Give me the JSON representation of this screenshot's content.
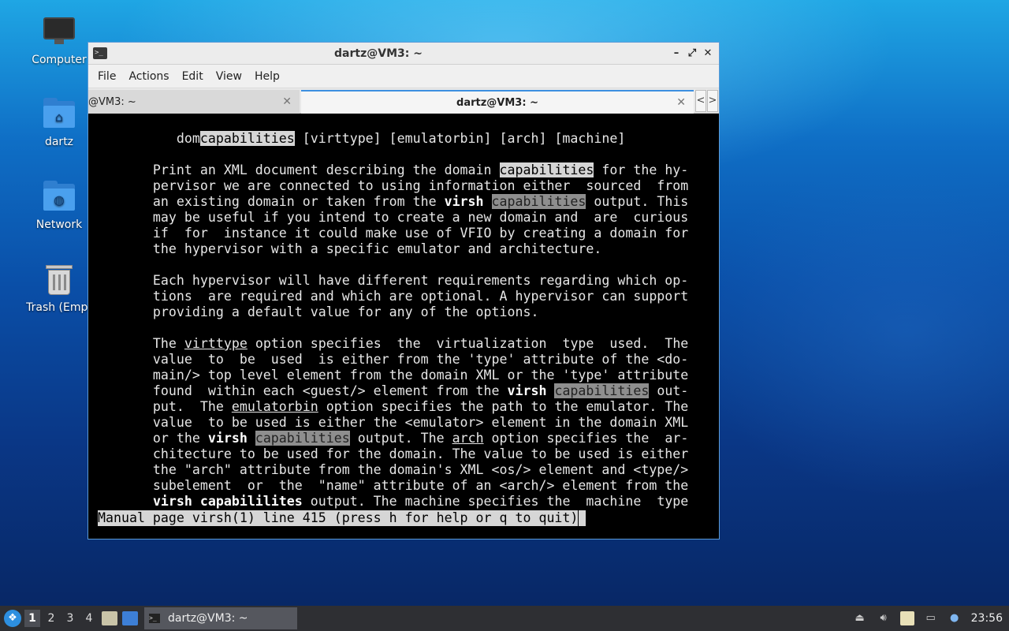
{
  "desktop": {
    "icons": [
      {
        "label": "Computer",
        "icon": "computer-icon"
      },
      {
        "label": "dartz",
        "icon": "home-folder-icon"
      },
      {
        "label": "Network",
        "icon": "network-folder-icon"
      },
      {
        "label": "Trash (Empt",
        "icon": "trash-icon"
      }
    ]
  },
  "window": {
    "title": "dartz@VM3: ~",
    "controls": {
      "minimize": "–",
      "maximize": "⤢",
      "close": "✕"
    },
    "menu": [
      "File",
      "Actions",
      "Edit",
      "View",
      "Help"
    ],
    "tabs": [
      {
        "label": "@VM3: ~",
        "close": "✕",
        "active": false
      },
      {
        "label": "dartz@VM3: ~",
        "close": "✕",
        "active": true
      }
    ],
    "tab_nav": {
      "prev": "<",
      "next": ">"
    }
  },
  "terminal": {
    "lines": [
      [
        {
          "t": "          dom"
        },
        {
          "t": "capabilities",
          "s": "hl"
        },
        {
          "t": " [virttype] [emulatorbin] [arch] [machine]"
        }
      ],
      [],
      [
        {
          "t": "       Print an XML document describing the domain "
        },
        {
          "t": "capabilities",
          "s": "hl"
        },
        {
          "t": " for the hy-"
        }
      ],
      [
        {
          "t": "       pervisor we are connected to using information either  sourced  from"
        }
      ],
      [
        {
          "t": "       an existing domain or taken from the "
        },
        {
          "t": "virsh",
          "s": "b"
        },
        {
          "t": " "
        },
        {
          "t": "capabilities",
          "s": "hl2"
        },
        {
          "t": " output. This"
        }
      ],
      [
        {
          "t": "       may be useful if you intend to create a new domain and  are  curious"
        }
      ],
      [
        {
          "t": "       if  for  instance it could make use of VFIO by creating a domain for"
        }
      ],
      [
        {
          "t": "       the hypervisor with a specific emulator and architecture."
        }
      ],
      [],
      [
        {
          "t": "       Each hypervisor will have different requirements regarding which op-"
        }
      ],
      [
        {
          "t": "       tions  are required and which are optional. A hypervisor can support"
        }
      ],
      [
        {
          "t": "       providing a default value for any of the options."
        }
      ],
      [],
      [
        {
          "t": "       The "
        },
        {
          "t": "virttype",
          "s": "u"
        },
        {
          "t": " option specifies  the  virtualization  type  used.  The"
        }
      ],
      [
        {
          "t": "       value  to  be  used  is either from the 'type' attribute of the <do-"
        }
      ],
      [
        {
          "t": "       main/> top level element from the domain XML or the 'type' attribute"
        }
      ],
      [
        {
          "t": "       found  within each <guest/> element from the "
        },
        {
          "t": "virsh",
          "s": "b"
        },
        {
          "t": " "
        },
        {
          "t": "capabilities",
          "s": "hl2"
        },
        {
          "t": " out-"
        }
      ],
      [
        {
          "t": "       put.  The "
        },
        {
          "t": "emulatorbin",
          "s": "u"
        },
        {
          "t": " option specifies the path to the emulator. The"
        }
      ],
      [
        {
          "t": "       value  to be used is either the <emulator> element in the domain XML"
        }
      ],
      [
        {
          "t": "       or the "
        },
        {
          "t": "virsh",
          "s": "b"
        },
        {
          "t": " "
        },
        {
          "t": "capabilities",
          "s": "hl2"
        },
        {
          "t": " output. The "
        },
        {
          "t": "arch",
          "s": "u"
        },
        {
          "t": " option specifies the  ar-"
        }
      ],
      [
        {
          "t": "       chitecture to be used for the domain. The value to be used is either"
        }
      ],
      [
        {
          "t": "       the \"arch\" attribute from the domain's XML <os/> element and <type/>"
        }
      ],
      [
        {
          "t": "       subelement  or  the  \"name\" attribute of an <arch/> element from the"
        }
      ],
      [
        {
          "t": "       "
        },
        {
          "t": "virsh capabililites",
          "s": "b"
        },
        {
          "t": " output. The machine specifies the  machine  type"
        }
      ]
    ],
    "status": "Manual page virsh(1) line 415 (press h for help or q to quit)"
  },
  "taskbar": {
    "start_icon": "start-menu-icon",
    "workspaces": [
      "1",
      "2",
      "3",
      "4"
    ],
    "active_workspace": "1",
    "launchers": [
      "file-manager-icon",
      "show-desktop-icon"
    ],
    "task": {
      "label": "dartz@VM3: ~",
      "icon": "terminal-icon"
    },
    "tray": [
      "eject-icon",
      "volume-icon",
      "clipboard-icon",
      "network-icon",
      "notification-icon"
    ],
    "clock": "23:56"
  }
}
